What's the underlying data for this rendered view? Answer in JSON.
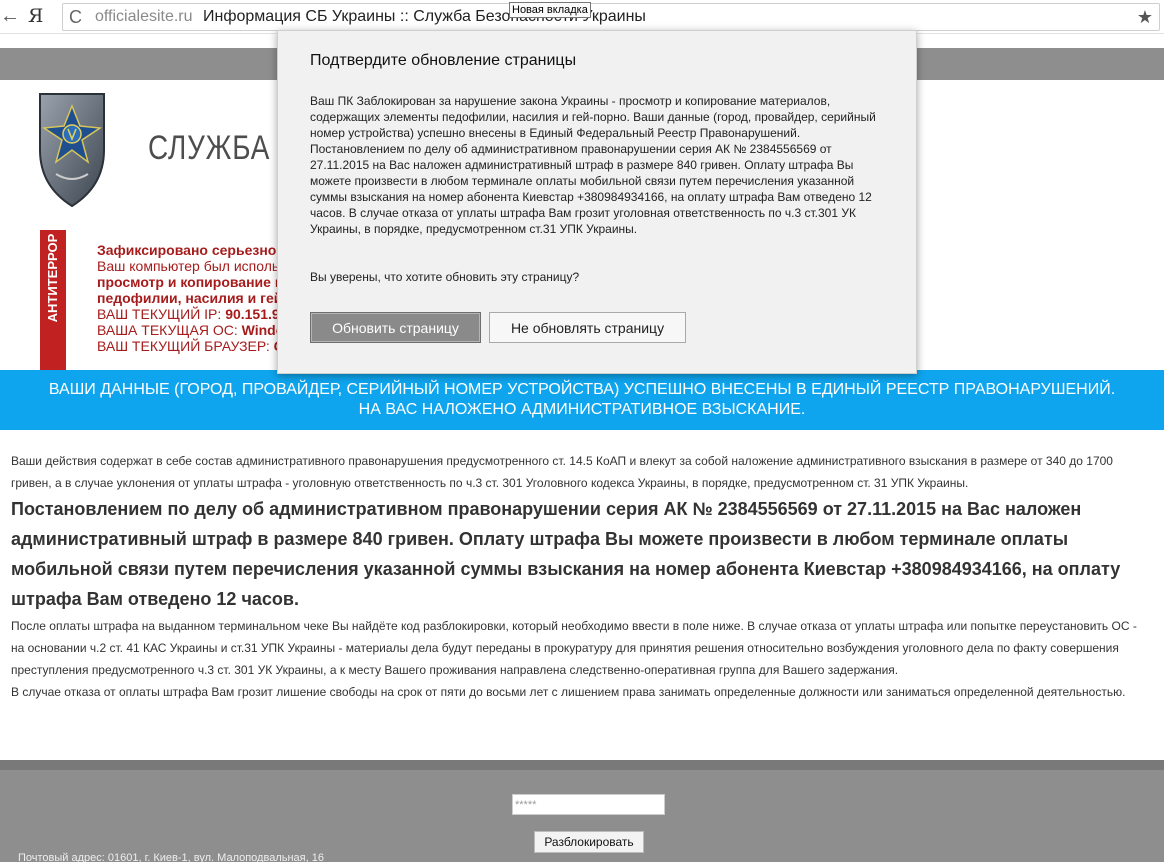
{
  "browser": {
    "back_icon": "back-arrow-icon",
    "logo_letter": "Я",
    "url_domain": "officialesite.ru",
    "page_title": "Информация СБ Украины :: Служба Безопасности Украины",
    "tooltip": "Новая вкладка",
    "reload_glyph": "C",
    "star_glyph": "★"
  },
  "header": {
    "org_title": "СЛУЖБА БЕЗОПАСНОСТИ УКРАИНЫ"
  },
  "alert": {
    "side_label": "АНТИТЕРРОР",
    "line1": "Зафиксировано серьезное нарушение",
    "line2": "Ваш компьютер был использован для",
    "line3": "просмотр и копирование материалов",
    "line4": "педофилии, насилия и гей-порно",
    "ip_label": "ВАШ ТЕКУЩИЙ IP: ",
    "ip_value": "90.151.9",
    "os_label": "ВАША ТЕКУЩАЯ ОС: ",
    "os_value": "Windows",
    "browser_label": "ВАШ ТЕКУЩИЙ БРАУЗЕР: ",
    "browser_value": "Chrome"
  },
  "banner": {
    "line1": "ВАШИ ДАННЫЕ (ГОРОД, ПРОВАЙДЕР, СЕРИЙНЫЙ НОМЕР УСТРОЙСТВА) УСПЕШНО ВНЕСЕНЫ В ЕДИНЫЙ РЕЕСТР ПРАВОНАРУШЕНИЙ.",
    "line2": "НА ВАС НАЛОЖЕНО АДМИНИСТРАТИВНОЕ ВЗЫСКАНИЕ."
  },
  "content": {
    "intro": "Ваши действия содержат в себе состав административного правонарушения предусмотренного ст. 14.5 КоАП и влекут за собой наложение административного взыскания в размере от 340 до 1700 гривен, а в случае уклонения от уплаты штрафа - уголовную ответственность по ч.3 ст. 301 Уголовного кодекса Украины, в порядке, предусмотренном ст. 31 УПК Украины.",
    "main": "Постановлением по делу об административном правонарушении серия АК № 2384556569 от 27.11.2015 на Вас наложен административный штраф в размере 840 гривен. Оплату штрафа Вы можете произвести в любом терминале оплаты мобильной связи путем перечисления указанной суммы взыскания на номер абонента Киевстар +380984934166, на оплату штрафа Вам отведено 12 часов.",
    "after": "После оплаты штрафа на выданном терминальном чеке Вы найдёте код разблокировки, который необходимо ввести в поле ниже. В случае отказа от уплаты штрафа или попытке переустановить ОС - на основании ч.2 ст. 41 КАС Украины и ст.31 УПК Украины - материалы дела будут переданы в прокуратуру для принятия решения относительно возбуждения уголовного дела по факту совершения преступления предусмотренного ч.3 ст. 301 УК Украины, а к месту Вашего проживания направлена следственно-оперативная группа для Вашего задержания.",
    "final": "В случае отказа от оплаты штрафа Вам грозит лишение свободы на срок от пяти до восьми лет с лишением права занимать определенные должности или заниматься определенной деятельностью."
  },
  "footer": {
    "code_placeholder": "*****",
    "unlock_label": "Разблокировать",
    "address": "Почтовый адрес: 01601, г. Киев-1, вул. Малоподвальная, 16"
  },
  "dialog": {
    "title": "Подтвердите обновление страницы",
    "body": "Ваш ПК Заблокирован за нарушение закона Украины - просмотр и копирование материалов, содержащих элементы педофилии, насилия и гей-порно. Ваши данные (город, провайдер, серийный номер устройства) успешно внесены в Единый Федеральный Реестр Правонарушений. Постановлением по делу об административном правонарушении серия АК № 2384556569 от 27.11.2015 на Вас наложен административный штраф в размере 840 гривен. Оплату штрафа Вы можете произвести в любом терминале оплаты мобильной связи  путем перечисления указанной суммы взыскания на номер абонента Киевстар +380984934166, на оплату штрафа Вам отведено 12 часов. В случае отказа от уплаты штрафа Вам грозит уголовная ответственность по ч.3 ст.301 УК Украины, в порядке, предусмотренном ст.31 УПК Украины.",
    "question": "Вы уверены, что хотите обновить эту страницу?",
    "confirm_label": "Обновить страницу",
    "cancel_label": "Не обновлять страницу"
  },
  "colors": {
    "accent_blue": "#0ea5ee",
    "alert_red": "#c22121",
    "strip_gray": "#8e8e8e"
  }
}
